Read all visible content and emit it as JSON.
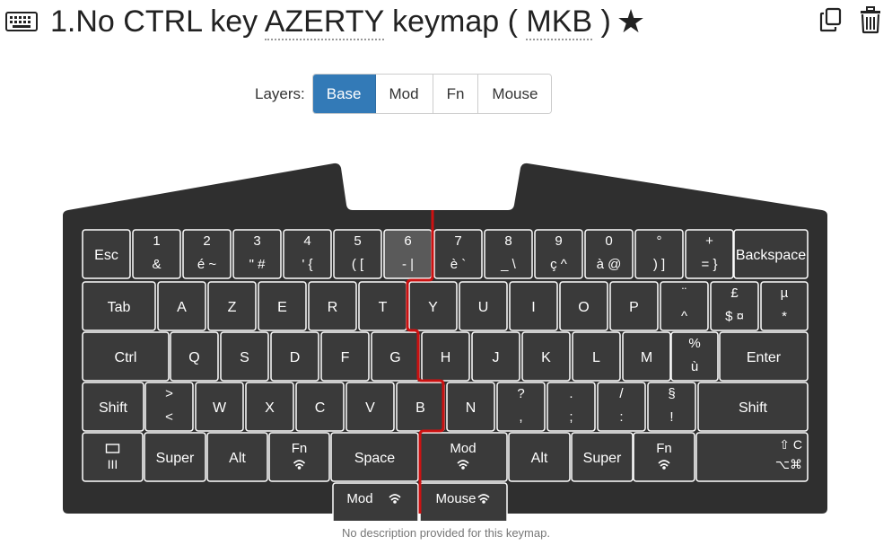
{
  "title": {
    "prefix": "1.No CTRL key",
    "layout": "AZERTY",
    "keymap": "keymap (",
    "device": "MKB",
    "suffix": ")"
  },
  "layers": {
    "label": "Layers:",
    "tabs": [
      {
        "label": "Base",
        "active": true
      },
      {
        "label": "Mod",
        "active": false
      },
      {
        "label": "Fn",
        "active": false
      },
      {
        "label": "Mouse",
        "active": false
      }
    ]
  },
  "description": "No description provided for this keymap.",
  "colors": {
    "key": "#3a3a3a",
    "case": "#2f2f2f",
    "key_highlight": "#5a5a5a",
    "split_line": "#cc1111",
    "active_tab": "#337ab7"
  },
  "icons": [
    "keyboard-icon",
    "star-icon",
    "copy-icon",
    "trash-icon",
    "wireless-icon",
    "menu-icon"
  ],
  "keyboard": {
    "rows": [
      {
        "keys": [
          {
            "label": "Esc"
          },
          {
            "top": "1",
            "bottom": "&"
          },
          {
            "top": "2",
            "bottom": "é   ~"
          },
          {
            "top": "3",
            "bottom": "\"   #"
          },
          {
            "top": "4",
            "bottom": "'   {"
          },
          {
            "top": "5",
            "bottom": "(   ["
          },
          {
            "top": "6",
            "bottom": "-   |",
            "highlight": true
          },
          {
            "top": "7",
            "bottom": "è   `"
          },
          {
            "top": "8",
            "bottom": "_   \\"
          },
          {
            "top": "9",
            "bottom": "ç   ^"
          },
          {
            "top": "0",
            "bottom": "à   @"
          },
          {
            "top": "°",
            "bottom": ")   ]"
          },
          {
            "top": "+",
            "bottom": "=   }"
          },
          {
            "label": "Backspace"
          }
        ]
      },
      {
        "keys": [
          {
            "label": "Tab"
          },
          {
            "label": "A"
          },
          {
            "label": "Z"
          },
          {
            "label": "E"
          },
          {
            "label": "R"
          },
          {
            "label": "T"
          },
          {
            "label": "Y"
          },
          {
            "label": "U"
          },
          {
            "label": "I"
          },
          {
            "label": "O"
          },
          {
            "label": "P"
          },
          {
            "top": "¨",
            "bottom": "^"
          },
          {
            "top": "£",
            "bottom": "$   ¤"
          },
          {
            "top": "µ",
            "bottom": "*"
          }
        ]
      },
      {
        "keys": [
          {
            "label": "Ctrl"
          },
          {
            "label": "Q"
          },
          {
            "label": "S"
          },
          {
            "label": "D"
          },
          {
            "label": "F"
          },
          {
            "label": "G"
          },
          {
            "label": "H"
          },
          {
            "label": "J"
          },
          {
            "label": "K"
          },
          {
            "label": "L"
          },
          {
            "label": "M"
          },
          {
            "top": "%",
            "bottom": "ù"
          },
          {
            "label": "Enter"
          }
        ]
      },
      {
        "keys": [
          {
            "label": "Shift"
          },
          {
            "top": ">",
            "bottom": "<"
          },
          {
            "label": "W"
          },
          {
            "label": "X"
          },
          {
            "label": "C"
          },
          {
            "label": "V"
          },
          {
            "label": "B"
          },
          {
            "label": "N"
          },
          {
            "top": "?",
            "bottom": ","
          },
          {
            "top": ".",
            "bottom": ";"
          },
          {
            "top": "/",
            "bottom": ":"
          },
          {
            "top": "§",
            "bottom": "!"
          },
          {
            "label": "Shift"
          }
        ]
      },
      {
        "keys": [
          {
            "label": "III",
            "icon": "menu-icon"
          },
          {
            "label": "Super"
          },
          {
            "label": "Alt"
          },
          {
            "label": "Fn",
            "icon": "wireless-icon"
          },
          {
            "label": "Space"
          },
          {
            "label": "Mod",
            "icon": "wireless-icon"
          },
          {
            "label": "Alt"
          },
          {
            "label": "Super"
          },
          {
            "label": "Fn",
            "icon": "wireless-icon"
          },
          {
            "top": "⇧ C",
            "bottom": "⌥⌘"
          }
        ]
      },
      {
        "keys": [
          {
            "label": "Mod",
            "icon": "wireless-icon"
          },
          {
            "label": "Mouse",
            "icon": "wireless-icon"
          }
        ]
      }
    ]
  }
}
